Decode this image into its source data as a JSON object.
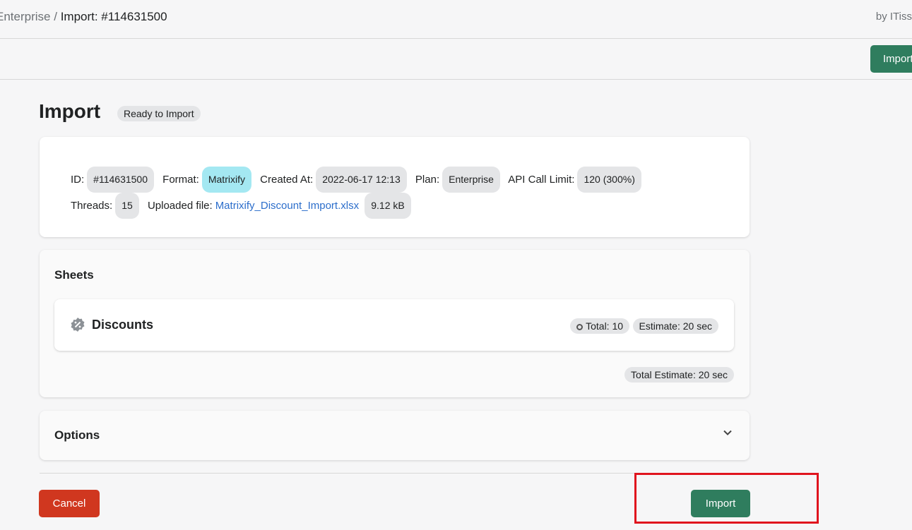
{
  "breadcrumb": {
    "parent": "Enterprise",
    "separator": "/",
    "current": "Import: #114631500"
  },
  "byline": "by ITiss",
  "actionbar": {
    "import_label": "Import"
  },
  "page": {
    "title": "Import",
    "status": "Ready to Import"
  },
  "info": {
    "id_label": "ID:",
    "id": "#114631500",
    "format_label": "Format:",
    "format": "Matrixify",
    "created_label": "Created At:",
    "created": "2022-06-17 12:13",
    "plan_label": "Plan:",
    "plan": "Enterprise",
    "api_label": "API Call Limit:",
    "api": "120 (300%)",
    "threads_label": "Threads:",
    "threads": "15",
    "file_label": "Uploaded file:",
    "file": "Matrixify_Discount_Import.xlsx",
    "file_size": "9.12 kB"
  },
  "sheets": {
    "title": "Sheets",
    "items": [
      {
        "name": "Discounts",
        "icon": "discount-icon",
        "total": "Total: 10",
        "estimate": "Estimate: 20 sec"
      }
    ],
    "total_estimate": "Total Estimate: 20 sec"
  },
  "options": {
    "title": "Options"
  },
  "footer": {
    "cancel": "Cancel",
    "import": "Import"
  },
  "colors": {
    "primary": "#2f7d5e",
    "danger": "#d0371f",
    "highlight": "#e0141e",
    "format_badge": "#a4e8f2"
  }
}
